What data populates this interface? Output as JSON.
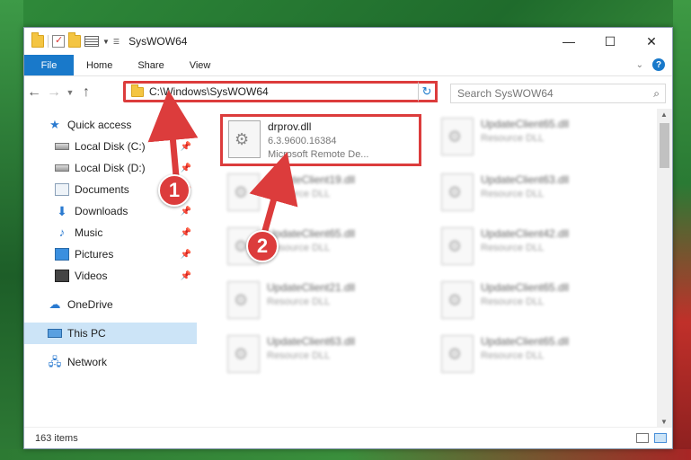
{
  "window": {
    "title": "SysWOW64",
    "controls": [
      "—",
      "☐",
      "✕"
    ]
  },
  "ribbon": {
    "tabs": [
      "File",
      "Home",
      "Share",
      "View"
    ]
  },
  "address": {
    "path": "C:\\Windows\\SysWOW64",
    "search_placeholder": "Search SysWOW64"
  },
  "sidebar": {
    "items": [
      {
        "label": "Quick access",
        "icon": "star-icon"
      },
      {
        "label": "Local Disk (C:)",
        "icon": "disk-icon",
        "pinned": true
      },
      {
        "label": "Local Disk (D:)",
        "icon": "disk-icon",
        "pinned": true
      },
      {
        "label": "Documents",
        "icon": "documents-icon",
        "pinned": true
      },
      {
        "label": "Downloads",
        "icon": "download-icon",
        "pinned": true
      },
      {
        "label": "Music",
        "icon": "music-icon",
        "pinned": true
      },
      {
        "label": "Pictures",
        "icon": "pictures-icon",
        "pinned": true
      },
      {
        "label": "Videos",
        "icon": "videos-icon",
        "pinned": true
      },
      {
        "label": "OneDrive",
        "icon": "cloud-icon"
      },
      {
        "label": "This PC",
        "icon": "computer-icon",
        "selected": true
      },
      {
        "label": "Network",
        "icon": "network-icon"
      }
    ]
  },
  "files": [
    {
      "name": "drprov.dll",
      "line1": "6.3.9600.16384",
      "line2": "Microsoft Remote De...",
      "highlight": true
    },
    {
      "name": "UpdateClient65.dll",
      "line1": "Resource DLL"
    },
    {
      "name": "UpdateClient19.dll",
      "line1": "Resource DLL"
    },
    {
      "name": "UpdateClient63.dll",
      "line1": "Resource DLL"
    },
    {
      "name": "UpdateClient65.dll",
      "line1": "Resource DLL"
    },
    {
      "name": "UpdateClient42.dll",
      "line1": "Resource DLL"
    },
    {
      "name": "UpdateClient21.dll",
      "line1": "Resource DLL"
    },
    {
      "name": "UpdateClient65.dll",
      "line1": "Resource DLL"
    },
    {
      "name": "UpdateClient63.dll",
      "line1": "Resource DLL"
    },
    {
      "name": "UpdateClient65.dll",
      "line1": "Resource DLL"
    }
  ],
  "status": {
    "item_count": "163 items"
  },
  "callouts": [
    "1",
    "2"
  ],
  "colors": {
    "accent": "#1979ca",
    "highlight": "#dc3c3c",
    "selected_bg": "#cce4f7"
  }
}
